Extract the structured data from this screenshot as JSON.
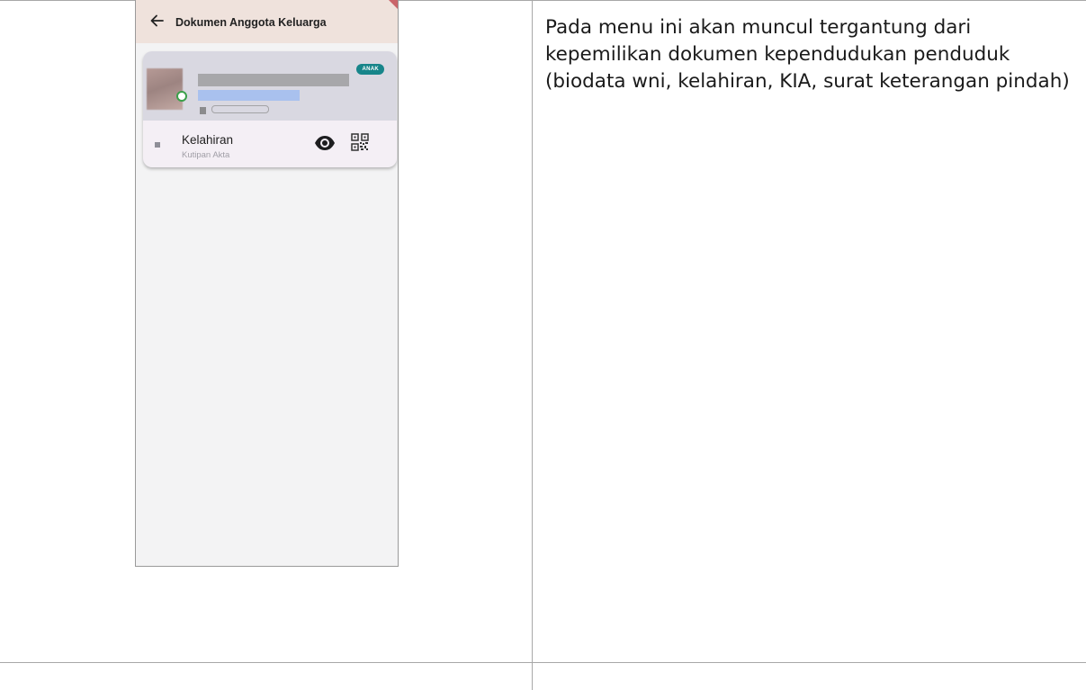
{
  "app": {
    "title": "Dokumen Anggota Keluarga",
    "back_icon": "arrow-left-icon"
  },
  "member_card": {
    "tag": "ANAK",
    "document_title": "Kelahiran",
    "document_subtitle": "Kutipan Akta",
    "view_icon": "eye-icon",
    "qr_icon": "qr-code-icon"
  },
  "description": "Pada menu ini akan muncul tergantung dari kepemilikan dokumen kependudukan penduduk (biodata wni, kelahiran, KIA, surat keterangan pindah)",
  "colors": {
    "appbar": "#efe2dc",
    "tag": "#17858a",
    "card_header": "#d9d8e1"
  }
}
